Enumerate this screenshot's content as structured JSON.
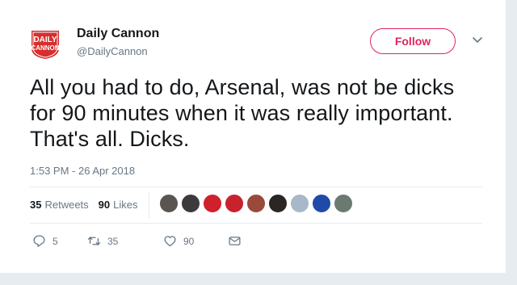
{
  "account": {
    "name": "Daily Cannon",
    "handle": "@DailyCannon",
    "logo_line1": "DAILY",
    "logo_line2": "CANNON"
  },
  "follow_label": "Follow",
  "tweet": {
    "text": "All you had to do, Arsenal, was not be dicks for 90 minutes when it was really important. That's all. Dicks.",
    "timestamp": "1:53 PM - 26 Apr 2018"
  },
  "stats": {
    "retweets_count": "35",
    "retweets_label": "Retweets",
    "likes_count": "90",
    "likes_label": "Likes"
  },
  "likers": [
    {
      "color": "#5a5550"
    },
    {
      "color": "#3d3a3c"
    },
    {
      "color": "#d0202a"
    },
    {
      "color": "#c8222d"
    },
    {
      "color": "#9a4a3a"
    },
    {
      "color": "#2b2623"
    },
    {
      "color": "#a8b8c8"
    },
    {
      "color": "#1f4aa8"
    },
    {
      "color": "#6b7a70"
    }
  ],
  "actions": {
    "replies": "5",
    "retweets": "35",
    "likes": "90"
  },
  "colors": {
    "accent": "#e0245e",
    "muted": "#657786"
  },
  "icons": {
    "caret": "chevron-down-icon",
    "reply": "reply-icon",
    "retweet": "retweet-icon",
    "like": "heart-icon",
    "dm": "envelope-icon"
  }
}
